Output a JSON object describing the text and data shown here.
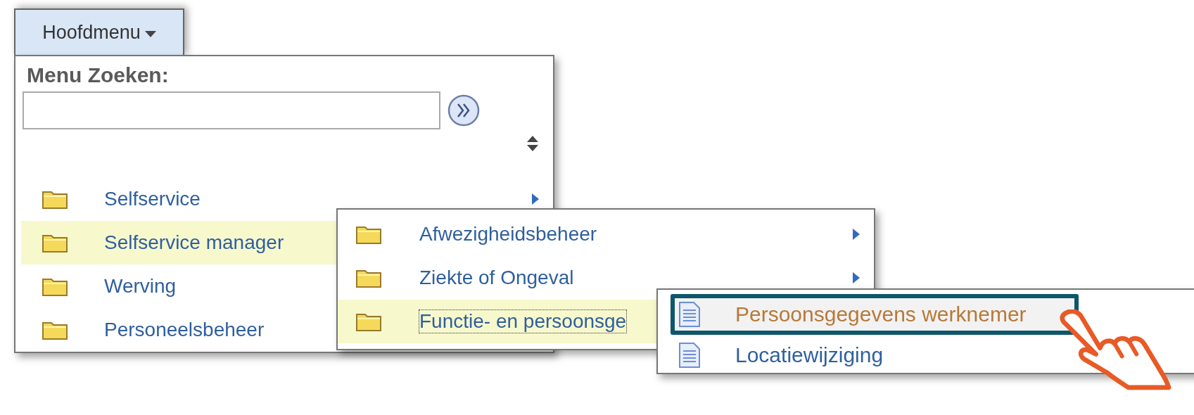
{
  "menu_button": {
    "label": "Hoofdmenu"
  },
  "search": {
    "label": "Menu Zoeken:"
  },
  "menu": {
    "items": [
      {
        "label": "Selfservice",
        "kind": "folder",
        "has_submenu": true,
        "selected": false
      },
      {
        "label": "Selfservice manager",
        "kind": "folder",
        "selected": true
      },
      {
        "label": "Werving",
        "kind": "folder",
        "selected": false
      },
      {
        "label": "Personeelsbeheer",
        "kind": "folder",
        "selected": false
      }
    ]
  },
  "submenu": {
    "items": [
      {
        "label": "Afwezigheidsbeheer",
        "kind": "folder",
        "has_submenu": true,
        "selected": false,
        "focused": false
      },
      {
        "label": "Ziekte of Ongeval",
        "kind": "folder",
        "has_submenu": true,
        "selected": false,
        "focused": false
      },
      {
        "label": "Functie- en persoonsge",
        "kind": "folder",
        "selected": true,
        "focused": true
      }
    ]
  },
  "submenu_2": {
    "items": [
      {
        "label": "Persoonsgegevens werknemer",
        "kind": "document",
        "selected": true,
        "outlined": true
      },
      {
        "label": "Locatiewijziging",
        "kind": "document",
        "selected": false,
        "outlined": false
      }
    ]
  }
}
